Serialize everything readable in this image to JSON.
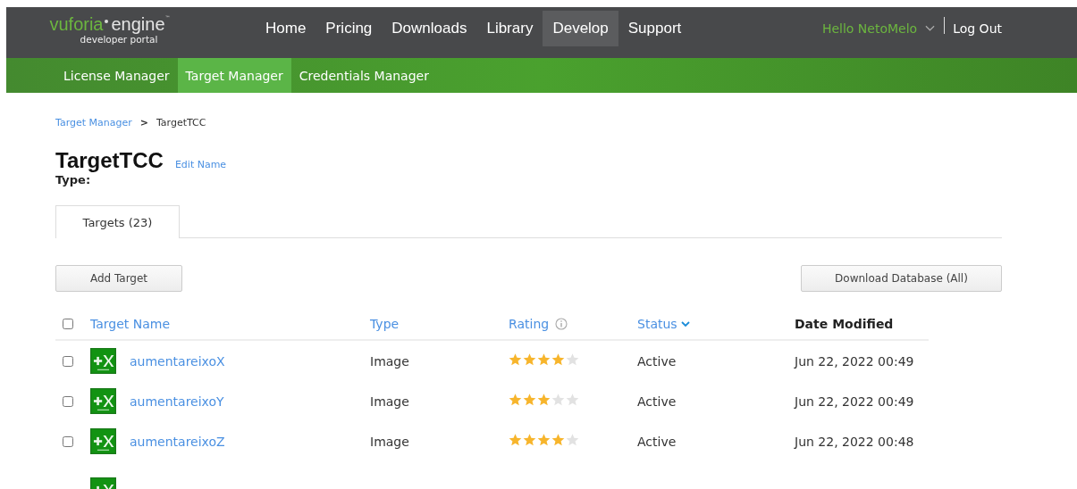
{
  "header": {
    "logo": {
      "wordmark": "vuforia",
      "product": "engine",
      "trademark": "™",
      "subtitle": "developer portal"
    },
    "nav": [
      {
        "label": "Home",
        "selected": false
      },
      {
        "label": "Pricing",
        "selected": false
      },
      {
        "label": "Downloads",
        "selected": false
      },
      {
        "label": "Library",
        "selected": false
      },
      {
        "label": "Develop",
        "selected": true
      },
      {
        "label": "Support",
        "selected": false
      }
    ],
    "user": "Hello NetoMelo",
    "logout": "Log Out"
  },
  "subnav": [
    {
      "label": "License Manager",
      "selected": false
    },
    {
      "label": "Target Manager",
      "selected": true
    },
    {
      "label": "Credentials Manager",
      "selected": false
    }
  ],
  "breadcrumb": {
    "link": "Target Manager",
    "separator": ">",
    "current": "TargetTCC"
  },
  "database": {
    "name": "TargetTCC",
    "edit": "Edit Name",
    "type_label": "Type:"
  },
  "tabs": [
    {
      "label": "Targets (23)",
      "selected": true
    }
  ],
  "buttons": {
    "add": "Add Target",
    "download": "Download Database (All)"
  },
  "table": {
    "select_all": {
      "checked": false
    },
    "columns": [
      {
        "label": "Target Name",
        "kind": "link"
      },
      {
        "label": "Type",
        "kind": "link"
      },
      {
        "label": "Rating",
        "kind": "info"
      },
      {
        "label": "Status",
        "kind": "sort"
      },
      {
        "label": "Date Modified",
        "kind": "plain"
      }
    ],
    "rows": [
      {
        "checked": false,
        "name": "aumentareixoX",
        "type": "Image",
        "stars": 4,
        "status": "Active",
        "date": "Jun 22, 2022 00:49"
      },
      {
        "checked": false,
        "name": "aumentareixoY",
        "type": "Image",
        "stars": 3,
        "status": "Active",
        "date": "Jun 22, 2022 00:49"
      },
      {
        "checked": false,
        "name": "aumentareixoZ",
        "type": "Image",
        "stars": 4,
        "status": "Active",
        "date": "Jun 22, 2022 00:48"
      }
    ]
  }
}
